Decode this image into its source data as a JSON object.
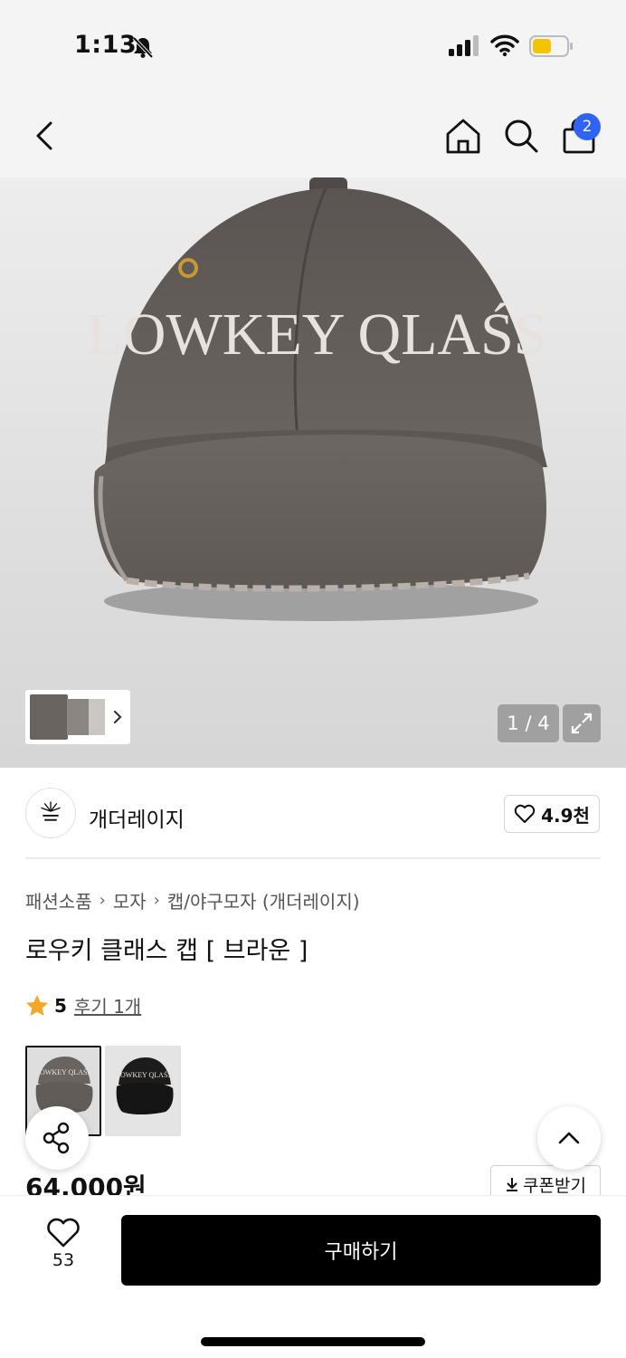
{
  "status_bar": {
    "time": "1:13"
  },
  "header": {
    "cart_count": "2"
  },
  "gallery": {
    "page_counter": "1 / 4",
    "cap_text": "LOWKEY QLAŚS"
  },
  "brand": {
    "name": "개더레이지",
    "likes": "4.9천"
  },
  "breadcrumb": [
    "패션소품",
    "모자",
    "캡/야구모자 (개더레이지)"
  ],
  "product": {
    "title": "로우키 클래스 캡 [ 브라운 ]",
    "rating": "5",
    "review_link": "후기 1개",
    "price": "64,000원",
    "coupon_label": "쿠폰받기"
  },
  "variants": [
    {
      "cap_text": "LOWKEY QLAŚS"
    },
    {
      "cap_text": "LOWKEY QLAŚS"
    }
  ],
  "bottom_bar": {
    "wish_count": "53",
    "buy_label": "구매하기"
  },
  "colors": {
    "accent_badge": "#2f63f5",
    "star": "#f5a623",
    "buy_button": "#000000"
  }
}
